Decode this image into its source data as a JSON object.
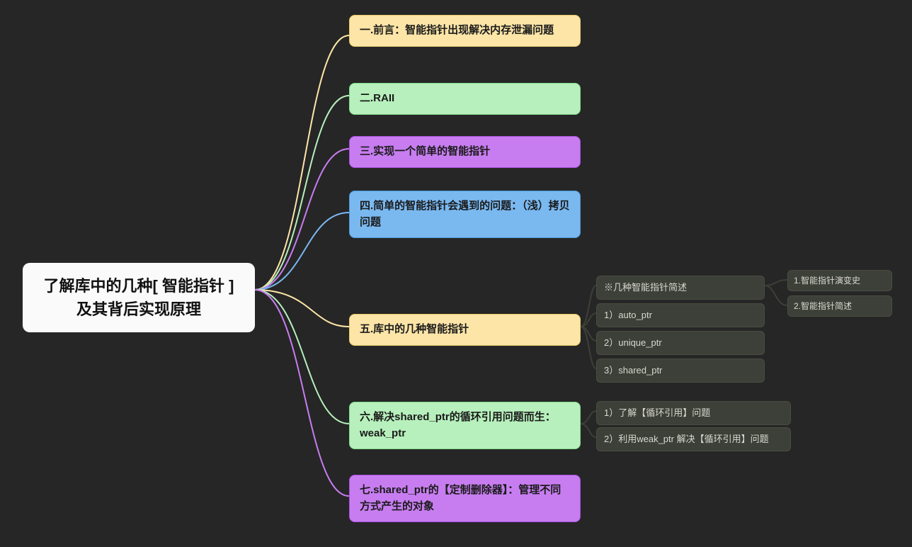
{
  "root": {
    "label": "了解库中的几种[ 智能指针 ]及其背后实现原理"
  },
  "level1": {
    "n1": "一.前言：智能指针出现解决内存泄漏问题",
    "n2": "二.RAII",
    "n3": "三.实现一个简单的智能指针",
    "n4": "四.简单的智能指针会遇到的问题：（浅）拷贝问题",
    "n5": "五.库中的几种智能指针",
    "n6": "六.解决shared_ptr的循环引用问题而生：weak_ptr",
    "n7": "七.shared_ptr的【定制删除器】：管理不同方式产生的对象"
  },
  "level2_5": {
    "a": "※几种智能指针简述",
    "b": "1）auto_ptr",
    "c": "2）unique_ptr",
    "d": "3）shared_ptr"
  },
  "level3_5a": {
    "a": "1.智能指针演变史",
    "b": "2.智能指针简述"
  },
  "level2_6": {
    "a": "1）了解【循环引用】问题",
    "b": "2）利用weak_ptr 解决【循环引用】问题"
  },
  "colors": {
    "rootStroke": "#fafafa",
    "yellowStroke": "#fde5a7",
    "greenStroke": "#b7f0bc",
    "purpleStroke": "#c77df0",
    "blueStroke": "#7ab8f0",
    "grayStroke": "#3d4038"
  }
}
